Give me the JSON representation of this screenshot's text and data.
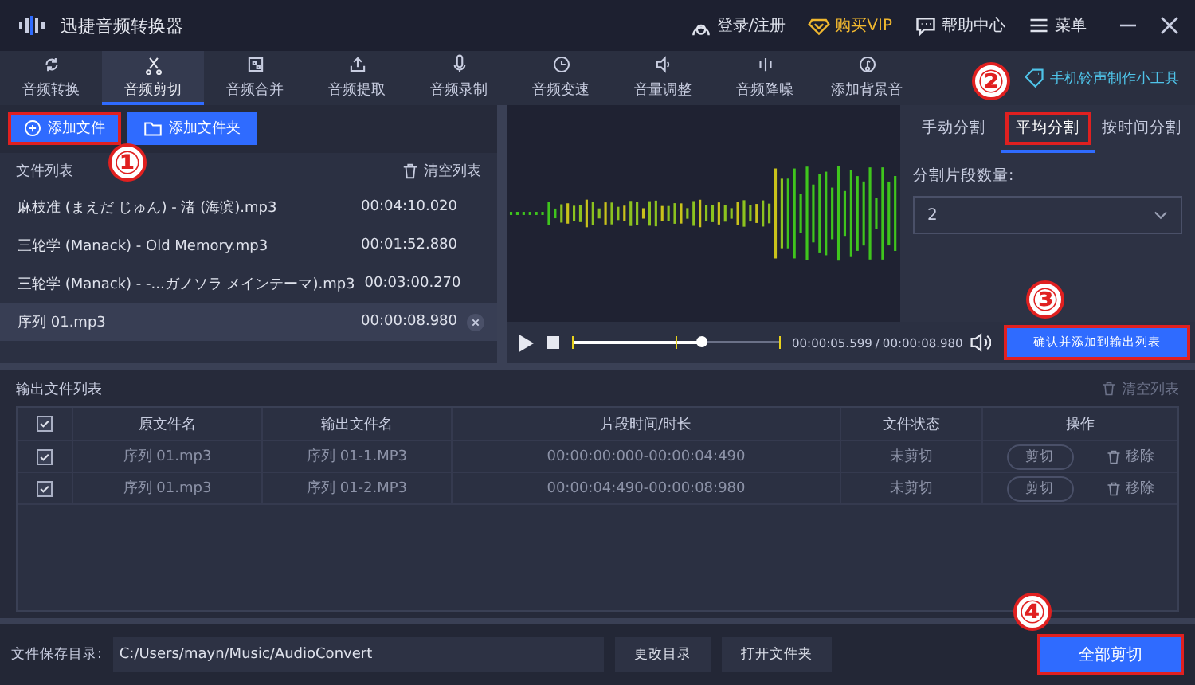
{
  "window": {
    "title": "迅捷音频转换器"
  },
  "header_links": [
    {
      "kind": "user",
      "label": "登录/注册"
    },
    {
      "kind": "vip",
      "label": "购买VIP"
    },
    {
      "kind": "help",
      "label": "帮助中心"
    },
    {
      "kind": "menu",
      "label": "菜单"
    }
  ],
  "tabs": [
    {
      "label": "音频转换",
      "selected": false
    },
    {
      "label": "音频剪切",
      "selected": true
    },
    {
      "label": "音频合并",
      "selected": false
    },
    {
      "label": "音频提取",
      "selected": false
    },
    {
      "label": "音频录制",
      "selected": false
    },
    {
      "label": "音频变速",
      "selected": false
    },
    {
      "label": "音量调整",
      "selected": false
    },
    {
      "label": "音频降噪",
      "selected": false
    },
    {
      "label": "添加背景音",
      "selected": false
    }
  ],
  "ringtone_link": "手机铃声制作小工具",
  "file_panel": {
    "add_file": {
      "label": "添加文件",
      "highlighted": true,
      "annotation": "①"
    },
    "add_folder": "添加文件夹",
    "list_title": "文件列表",
    "clear": "清空列表",
    "files": [
      {
        "name": "麻枝准 (まえだ じゅん) - 渚 (海滨).mp3",
        "duration": "00:04:10.020",
        "selected": false
      },
      {
        "name": "三轮学 (Manack) - Old Memory.mp3",
        "duration": "00:01:52.880",
        "selected": false
      },
      {
        "name": "三轮学 (Manack) - -...ガノソラ メインテーマ).mp3",
        "duration": "00:03:00.270",
        "selected": false
      },
      {
        "name": "序列 01.mp3",
        "duration": "00:00:08.980",
        "selected": true
      }
    ]
  },
  "split_panel": {
    "tabs": [
      {
        "label": "手动分割",
        "selected": false,
        "highlighted": false
      },
      {
        "label": "平均分割",
        "selected": true,
        "highlighted": true
      },
      {
        "label": "按时间分割",
        "selected": false,
        "highlighted": false
      }
    ],
    "tab_annotation": "②",
    "count_label": "分割片段数量:",
    "count_value": "2",
    "confirm": {
      "label": "确认并添加到输出列表",
      "highlighted": true,
      "annotation": "③"
    }
  },
  "player": {
    "level": 0.62,
    "current": "00:00:05.599",
    "separator": "/",
    "total": "00:00:08.980"
  },
  "output": {
    "title": "输出文件列表",
    "clear": "清空列表",
    "columns": [
      "原文件名",
      "输出文件名",
      "片段时间/时长",
      "文件状态",
      "操作"
    ],
    "all_checked": true,
    "rows": [
      {
        "checked": true,
        "source": "序列 01.mp3",
        "output": "序列 01-1.MP3",
        "range": "00:00:00:000-00:00:04:490",
        "status": "未剪切",
        "cut": "剪切",
        "remove": "移除"
      },
      {
        "checked": true,
        "source": "序列 01.mp3",
        "output": "序列 01-2.MP3",
        "range": "00:00:04:490-00:00:08:980",
        "status": "未剪切",
        "cut": "剪切",
        "remove": "移除"
      }
    ]
  },
  "footer": {
    "save_label": "文件保存目录:",
    "path": "C:/Users/mayn/Music/AudioConvert",
    "change_dir": "更改目录",
    "open_folder": "打开文件夹",
    "cut_all": {
      "label": "全部剪切",
      "highlighted": true,
      "annotation": "④"
    }
  }
}
